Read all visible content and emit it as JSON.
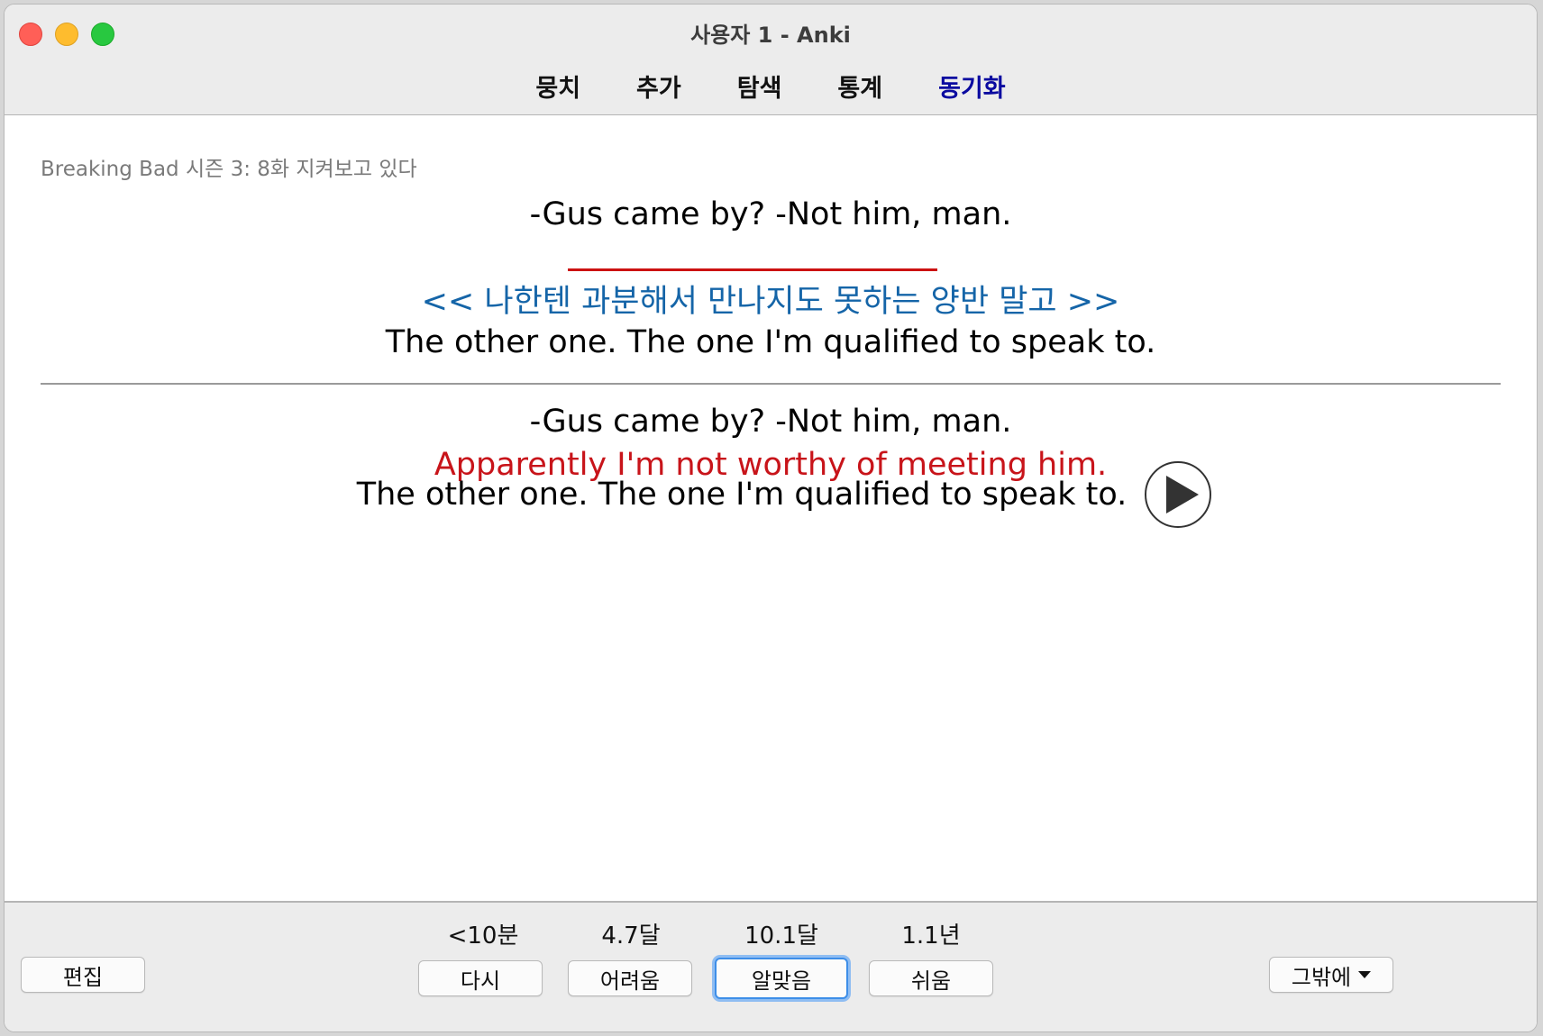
{
  "window": {
    "title": "사용자 1 - Anki"
  },
  "toolbar": {
    "items": [
      {
        "label": "뭉치"
      },
      {
        "label": "추가"
      },
      {
        "label": "탐색"
      },
      {
        "label": "통계"
      },
      {
        "label": "동기화"
      }
    ]
  },
  "card": {
    "deck_info": "Breaking Bad 시즌 3: 8화 지켜보고 있다",
    "question_line1": "-Gus came by? -Not him, man.",
    "question_hint": "<< 나한텐 과분해서 만나지도 못하는 양반 말고 >>",
    "question_line2": "The other one. The one I'm qualified to speak to.",
    "answer_line1": "-Gus came by? -Not him, man.",
    "answer_line2": "Apparently I'm not worthy of meeting him.",
    "answer_line3": "The other one. The one I'm qualified to speak to."
  },
  "bottom": {
    "edit_label": "편집",
    "more_label": "그밖에",
    "answers": [
      {
        "interval": "<10분",
        "label": "다시"
      },
      {
        "interval": "4.7달",
        "label": "어려움"
      },
      {
        "interval": "10.1달",
        "label": "알맞음"
      },
      {
        "interval": "1.1년",
        "label": "쉬움"
      }
    ]
  },
  "colors": {
    "hint": "#1565a8",
    "answer_highlight": "#c8141a",
    "sync_link": "#0a0aa0",
    "hint_mark": "#cc1111"
  },
  "icons": {
    "audio": "play-icon",
    "more": "chevron-down-icon"
  }
}
